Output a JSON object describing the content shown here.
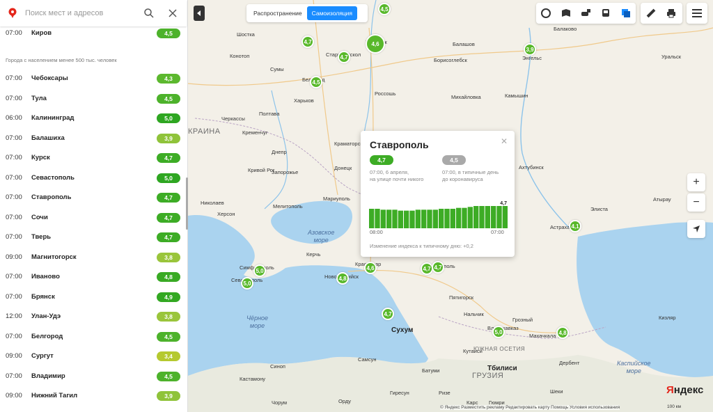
{
  "search": {
    "placeholder": "Поиск мест и адресов"
  },
  "list": {
    "top_row": {
      "time": "07:00",
      "city": "Киров",
      "score": "4,5",
      "color": "#4db22b"
    },
    "section_label": "Города с населением менее 500 тыс. человек",
    "rows": [
      {
        "time": "07:00",
        "city": "Чебоксары",
        "score": "4,3",
        "color": "#5cb82e"
      },
      {
        "time": "07:00",
        "city": "Тула",
        "score": "4,5",
        "color": "#4db22b"
      },
      {
        "time": "06:00",
        "city": "Калининград",
        "score": "5,0",
        "color": "#2ea621"
      },
      {
        "time": "07:00",
        "city": "Балашиха",
        "score": "3,9",
        "color": "#8fc33a"
      },
      {
        "time": "07:00",
        "city": "Курск",
        "score": "4,7",
        "color": "#3dac25"
      },
      {
        "time": "07:00",
        "city": "Севастополь",
        "score": "5,0",
        "color": "#2ea621"
      },
      {
        "time": "07:00",
        "city": "Ставрополь",
        "score": "4,7",
        "color": "#3dac25"
      },
      {
        "time": "07:00",
        "city": "Сочи",
        "score": "4,7",
        "color": "#3dac25"
      },
      {
        "time": "07:00",
        "city": "Тверь",
        "score": "4,7",
        "color": "#3dac25"
      },
      {
        "time": "09:00",
        "city": "Магнитогорск",
        "score": "3,8",
        "color": "#9ac53b"
      },
      {
        "time": "07:00",
        "city": "Иваново",
        "score": "4,8",
        "color": "#39aa24"
      },
      {
        "time": "07:00",
        "city": "Брянск",
        "score": "4,9",
        "color": "#33a822"
      },
      {
        "time": "12:00",
        "city": "Улан-Удэ",
        "score": "3,8",
        "color": "#9ac53b"
      },
      {
        "time": "07:00",
        "city": "Белгород",
        "score": "4,5",
        "color": "#4db22b"
      },
      {
        "time": "09:00",
        "city": "Сургут",
        "score": "3,4",
        "color": "#b5c92f"
      },
      {
        "time": "07:00",
        "city": "Владимир",
        "score": "4,5",
        "color": "#4db22b"
      },
      {
        "time": "09:00",
        "city": "Нижний Тагил",
        "score": "3,9",
        "color": "#8fc33a"
      }
    ]
  },
  "modes": {
    "spread": "Распространение",
    "isolation": "Самоизоляция",
    "active": "isolation"
  },
  "toolbar": {
    "icons": [
      "traffic-icon",
      "panorama-icon",
      "parking-icon",
      "transit-icon",
      "layers-icon",
      "ruler-icon",
      "print-icon",
      "menu-icon"
    ]
  },
  "popup": {
    "title": "Ставрополь",
    "current_score": "4,7",
    "current_note_1": "07:00, 6 апреля,",
    "current_note_2": "на улице почти никого",
    "typical_score": "4,5",
    "typical_note_1": "07:00, в типичные день",
    "typical_note_2": "до коронавируса",
    "chart_last_label": "4,7",
    "tick_start": "08:00",
    "tick_end": "07:00",
    "delta_text": "Изменение индекса к типичному дню: +0,2"
  },
  "chart_data": {
    "type": "bar",
    "title": "Ставрополь",
    "categories": [
      "08:00",
      "",
      "",
      "",
      "",
      "",
      "",
      "",
      "",
      "",
      "",
      "",
      "",
      "",
      "",
      "",
      "",
      "",
      "",
      "",
      "",
      "",
      "",
      "07:00"
    ],
    "values": [
      4.55,
      4.55,
      4.5,
      4.5,
      4.5,
      4.45,
      4.45,
      4.45,
      4.5,
      4.5,
      4.5,
      4.5,
      4.55,
      4.55,
      4.55,
      4.6,
      4.6,
      4.65,
      4.7,
      4.7,
      4.7,
      4.7,
      4.7,
      4.7
    ],
    "ylim": [
      3.5,
      5.0
    ],
    "xlabel": "",
    "ylabel": "",
    "annotations": [
      "4,7"
    ],
    "grid": false
  },
  "map": {
    "labels": [
      {
        "text": "Шостка",
        "cls": "city"
      },
      {
        "text": "Конотоп",
        "cls": "city"
      },
      {
        "text": "Сумы",
        "cls": "city"
      },
      {
        "text": "Харьков",
        "cls": "city"
      },
      {
        "text": "Полтава",
        "cls": "city"
      },
      {
        "text": "Черкассы",
        "cls": "city"
      },
      {
        "text": "Кременчуг",
        "cls": "city"
      },
      {
        "text": "Днепр",
        "cls": "city"
      },
      {
        "text": "Кривой Рог",
        "cls": "city"
      },
      {
        "text": "Запорожье",
        "cls": "city"
      },
      {
        "text": "Николаев",
        "cls": "city"
      },
      {
        "text": "Херсон",
        "cls": "city"
      },
      {
        "text": "Мелитополь",
        "cls": "city"
      },
      {
        "text": "Мариуполь",
        "cls": "city"
      },
      {
        "text": "Донецк",
        "cls": "city"
      },
      {
        "text": "Краматорск",
        "cls": "city"
      },
      {
        "text": "Россошь",
        "cls": "city"
      },
      {
        "text": "Белгород",
        "cls": "city"
      },
      {
        "text": "Старый Оскол",
        "cls": "city"
      },
      {
        "text": "Воронеж",
        "cls": "city"
      },
      {
        "text": "Балашов",
        "cls": "city"
      },
      {
        "text": "Борисоглебск",
        "cls": "city"
      },
      {
        "text": "Михайловка",
        "cls": "city"
      },
      {
        "text": "Камышин",
        "cls": "city"
      },
      {
        "text": "Балаково",
        "cls": "city"
      },
      {
        "text": "Энгельс",
        "cls": "city"
      },
      {
        "text": "Уральск",
        "cls": "city"
      },
      {
        "text": "Ахтубинск",
        "cls": "city"
      },
      {
        "text": "Астрахань",
        "cls": "city"
      },
      {
        "text": "Атырау",
        "cls": "city"
      },
      {
        "text": "Симферополь",
        "cls": "city"
      },
      {
        "text": "Севастополь",
        "cls": "city"
      },
      {
        "text": "Керчь",
        "cls": "city"
      },
      {
        "text": "Новороссийск",
        "cls": "city"
      },
      {
        "text": "Краснодар",
        "cls": "city"
      },
      {
        "text": "Ставрополь",
        "cls": "city"
      },
      {
        "text": "Пятигорск",
        "cls": "city"
      },
      {
        "text": "Нальчик",
        "cls": "city"
      },
      {
        "text": "Грозный",
        "cls": "city"
      },
      {
        "text": "Владикавказ",
        "cls": "city"
      },
      {
        "text": "Махачкала",
        "cls": "city"
      },
      {
        "text": "Дербент",
        "cls": "city"
      },
      {
        "text": "Сухум",
        "cls": "city big"
      },
      {
        "text": "Кутаиси",
        "cls": "city"
      },
      {
        "text": "Тбилиси",
        "cls": "city big"
      },
      {
        "text": "Батуми",
        "cls": "city"
      },
      {
        "text": "Синоп",
        "cls": "city"
      },
      {
        "text": "Самсун",
        "cls": "city"
      },
      {
        "text": "Кастамону",
        "cls": "city"
      },
      {
        "text": "Чорум",
        "cls": "city"
      },
      {
        "text": "Орду",
        "cls": "city"
      },
      {
        "text": "Гиресун",
        "cls": "city"
      },
      {
        "text": "Ризе",
        "cls": "city"
      },
      {
        "text": "Карс",
        "cls": "city"
      },
      {
        "text": "Гюмри",
        "cls": "city"
      },
      {
        "text": "Шеки",
        "cls": "city"
      },
      {
        "text": "Кизляр",
        "cls": "city"
      },
      {
        "text": "Элиста",
        "cls": "city"
      }
    ],
    "regions": [
      "КРАИНА",
      "ЮЖНАЯ ОСЕТИЯ",
      "ГРУЗИЯ"
    ],
    "seas": [
      {
        "l1": "Азовское",
        "l2": "море"
      },
      {
        "l1": "Чёрное",
        "l2": "море"
      },
      {
        "l1": "Каспийское",
        "l2": "море"
      }
    ],
    "bubbles": [
      {
        "v": "4,5"
      },
      {
        "v": "4,7"
      },
      {
        "v": "4,7"
      },
      {
        "v": "4,6"
      },
      {
        "v": "3,9"
      },
      {
        "v": "4,5"
      },
      {
        "v": "4,7"
      },
      {
        "v": "4,1"
      },
      {
        "v": "5,0"
      },
      {
        "v": "5,0"
      },
      {
        "v": "4,8"
      },
      {
        "v": "4,6"
      },
      {
        "v": "4,7"
      },
      {
        "v": "5,0"
      },
      {
        "v": "4,8"
      },
      {
        "v": "4,7"
      }
    ]
  },
  "footer": {
    "copyright": "© Яндекс   Разместить рекламу   Редактировать карту   Помощь   Условия использования",
    "brand_1": "Я",
    "brand_2": "ндекс",
    "scale": "100 км"
  }
}
